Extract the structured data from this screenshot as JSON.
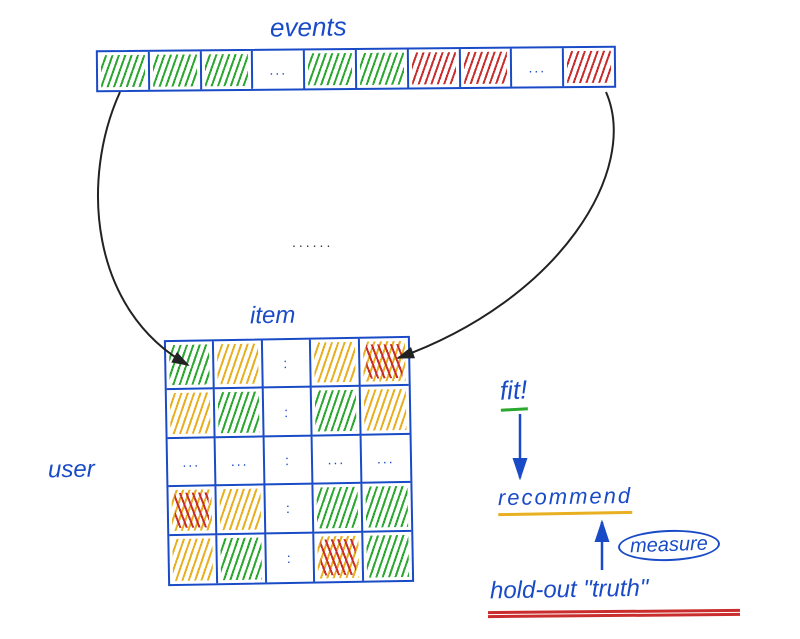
{
  "labels": {
    "events": "events",
    "item": "item",
    "user": "user",
    "fit": "fit!",
    "recommend": "recommend",
    "measure": "measure",
    "holdout": "hold-out \"truth\""
  },
  "ellipsis": {
    "mid": "......",
    "cell_dots": "...",
    "col_dots": ":",
    "row_dots": "..."
  },
  "events_row": [
    {
      "fill": "green"
    },
    {
      "fill": "green"
    },
    {
      "fill": "green"
    },
    {
      "fill": "dots"
    },
    {
      "fill": "green"
    },
    {
      "fill": "green"
    },
    {
      "fill": "red"
    },
    {
      "fill": "red"
    },
    {
      "fill": "dots"
    },
    {
      "fill": "red"
    }
  ],
  "matrix": [
    [
      {
        "fill": "green"
      },
      {
        "fill": "yellow"
      },
      {
        "fill": "coldots"
      },
      {
        "fill": "yellow"
      },
      {
        "fill": "yellow-red"
      }
    ],
    [
      {
        "fill": "yellow"
      },
      {
        "fill": "green"
      },
      {
        "fill": "coldots"
      },
      {
        "fill": "green"
      },
      {
        "fill": "yellow"
      }
    ],
    [
      {
        "fill": "rowdots"
      },
      {
        "fill": "rowdots"
      },
      {
        "fill": "coldots"
      },
      {
        "fill": "rowdots"
      },
      {
        "fill": "rowdots"
      }
    ],
    [
      {
        "fill": "yellow-red"
      },
      {
        "fill": "yellow"
      },
      {
        "fill": "coldots"
      },
      {
        "fill": "green"
      },
      {
        "fill": "green"
      }
    ],
    [
      {
        "fill": "yellow"
      },
      {
        "fill": "green"
      },
      {
        "fill": "coldots"
      },
      {
        "fill": "yellow-red"
      },
      {
        "fill": "green"
      }
    ]
  ],
  "flow": [
    "fit",
    "recommend",
    "hold-out truth"
  ],
  "flow_annotation": "measure",
  "colors": {
    "ink": "#1a4bc7",
    "green": "#2aa82f",
    "red": "#c92d2d",
    "yellow": "#e8b020",
    "dark": "#222222"
  }
}
